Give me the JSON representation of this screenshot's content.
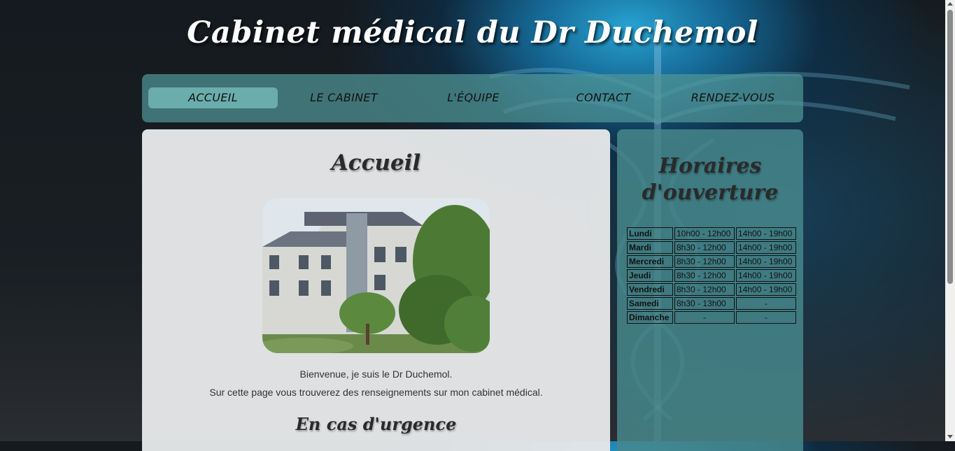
{
  "header": {
    "title": "Cabinet médical du Dr Duchemol"
  },
  "nav": {
    "items": [
      {
        "label": "ACCUEIL",
        "active": true
      },
      {
        "label": "LE CABINET",
        "active": false
      },
      {
        "label": "L'ÉQUIPE",
        "active": false
      },
      {
        "label": "CONTACT",
        "active": false
      },
      {
        "label": "RENDEZ-VOUS",
        "active": false
      }
    ]
  },
  "main": {
    "heading": "Accueil",
    "intro_line1": "Bienvenue, je suis le Dr Duchemol.",
    "intro_line2": "Sur cette page vous trouverez des renseignements sur mon cabinet médical.",
    "urgence_heading": "En cas d'urgence"
  },
  "aside": {
    "heading": "Horaires d'ouverture",
    "hours": [
      {
        "day": "Lundi",
        "am": "10h00 - 12h00",
        "pm": "14h00 - 19h00"
      },
      {
        "day": "Mardi",
        "am": "8h30 - 12h00",
        "pm": "14h00 - 19h00"
      },
      {
        "day": "Mercredi",
        "am": "8h30 - 12h00",
        "pm": "14h00 - 19h00"
      },
      {
        "day": "Jeudi",
        "am": "8h30 - 12h00",
        "pm": "14h00 - 19h00"
      },
      {
        "day": "Vendredi",
        "am": "8h30 - 12h00",
        "pm": "14h00 - 19h00"
      },
      {
        "day": "Samedi",
        "am": "8h30 - 13h00",
        "pm": "-"
      },
      {
        "day": "Dimanche",
        "am": "-",
        "pm": "-"
      }
    ]
  },
  "colors": {
    "nav_bg": "#4f9696",
    "nav_active": "#6eafaf",
    "main_bg": "#e6e8e9",
    "aside_bg": "#46878c",
    "title": "#ffffff"
  }
}
